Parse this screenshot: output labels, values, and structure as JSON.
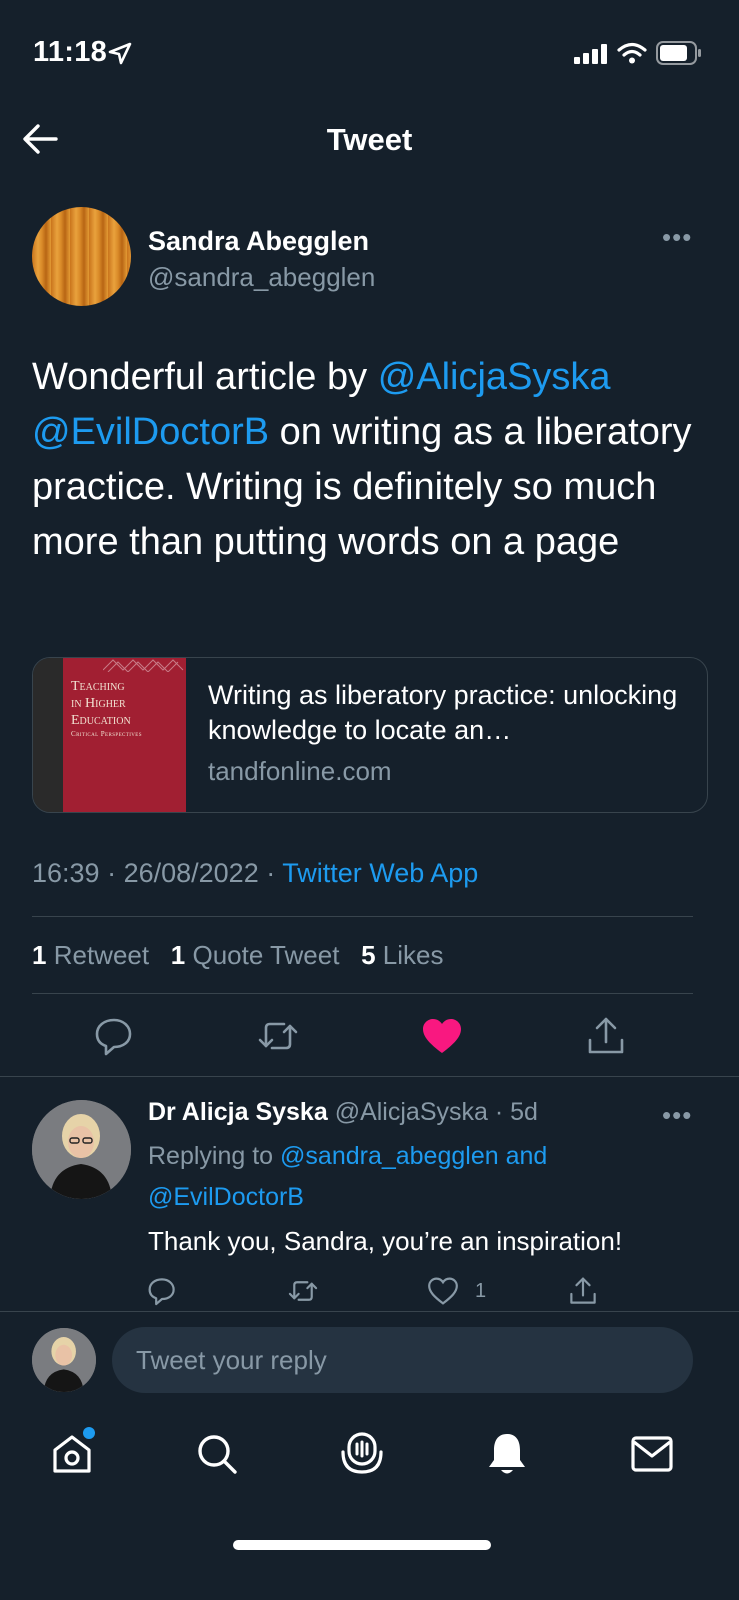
{
  "status_bar": {
    "time": "11:18"
  },
  "header": {
    "title": "Tweet"
  },
  "tweet": {
    "author_name": "Sandra Abegglen",
    "author_handle": "@sandra_abegglen",
    "text_part1": "Wonderful article by ",
    "mention1": "@AlicjaSyska",
    "mention2": "@EvilDoctorB",
    "text_part2": " on writing as a liberatory practice. Writing is definitely so much more than putting words on a page",
    "card": {
      "cover_line1": "Teaching",
      "cover_line2": "in Higher",
      "cover_line3": "Education",
      "cover_sub": "Critical Perspectives",
      "title": "Writing as liberatory practice: unlocking knowledge to locate an…",
      "domain": "tandfonline.com"
    },
    "time": "16:39",
    "date": "26/08/2022",
    "source": "Twitter Web App",
    "stats": {
      "retweets_count": "1",
      "retweets_label": "Retweet",
      "quotes_count": "1",
      "quotes_label": "Quote Tweet",
      "likes_count": "5",
      "likes_label": "Likes"
    },
    "liked": true
  },
  "reply": {
    "author_name": "Dr Alicja Syska",
    "author_handle": "@AlicjaSyska",
    "age": "5d",
    "replying_prefix": "Replying to ",
    "replying_to": "@sandra_abegglen and @EvilDoctorB",
    "text": "Thank you, Sandra, you’re an inspiration!",
    "like_count": "1"
  },
  "compose": {
    "placeholder": "Tweet your reply"
  },
  "colors": {
    "background": "#15202b",
    "accent": "#1d9bf0",
    "like": "#f91880",
    "muted": "#8899a6",
    "divider": "#38444d"
  },
  "icons": [
    "back-arrow-icon",
    "more-icon",
    "reply-icon",
    "retweet-icon",
    "like-icon",
    "share-icon",
    "home-icon",
    "search-icon",
    "spaces-icon",
    "notifications-icon",
    "messages-icon"
  ]
}
